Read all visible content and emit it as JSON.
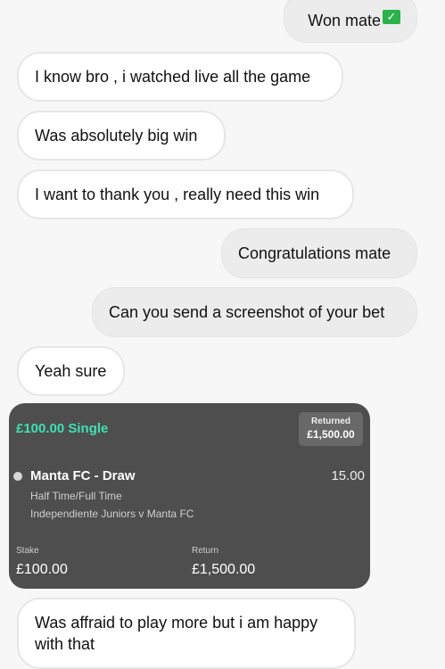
{
  "messages": {
    "m0": "Won mate",
    "m1": "I know bro , i watched live all the game",
    "m2": "Was absolutely big win",
    "m3": "I want to thank you , really need this win",
    "m4": "Congratulations mate",
    "m5": "Can you send a screenshot of your bet",
    "m6": "Yeah sure",
    "m7a": "Was affraid to play more but i am happy",
    "m7b": "with that"
  },
  "check_glyph": "✓",
  "bet": {
    "title": "£100.00 Single",
    "returned_label": "Returned",
    "returned_value": "£1,500.00",
    "selection": "Manta FC - Draw",
    "odds": "15.00",
    "market": "Half Time/Full Time",
    "event": "Independiente Juniors v Manta FC",
    "stake_label": "Stake",
    "stake_value": "£100.00",
    "return_label": "Return",
    "return_value": "£1,500.00",
    "accent_color": "#3fe0b5",
    "card_color": "#4e4e4e"
  }
}
